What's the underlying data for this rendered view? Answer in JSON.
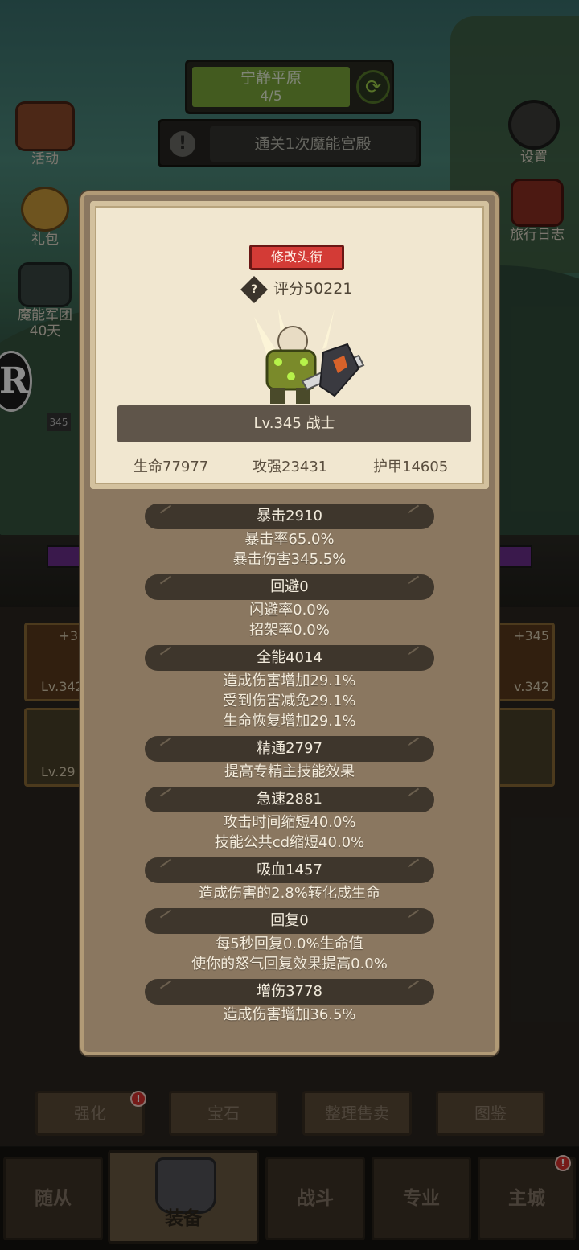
{
  "stage": {
    "name": "宁静平原",
    "progress": "4/5"
  },
  "quest": {
    "text": "通关1次魔能宫殿"
  },
  "left_menu": [
    {
      "label": "活动"
    },
    {
      "label": "礼包"
    },
    {
      "label": "魔能军团",
      "sub": "40天"
    }
  ],
  "right_menu": [
    {
      "label": "设置"
    },
    {
      "label": "旅行日志"
    }
  ],
  "background_slots": {
    "level_tag": "345",
    "left_top": {
      "bonus": "+3",
      "level": "Lv.342"
    },
    "left_bottom": {
      "level": "Lv.29"
    },
    "right_top": {
      "bonus": "+345",
      "level": "v.342"
    }
  },
  "panel": {
    "title_button": "修改头衔",
    "score": "评分50221",
    "level_class": "Lv.345 战士",
    "core_stats": {
      "hp": "生命77977",
      "attack": "攻强23431",
      "armor": "护甲14605"
    },
    "sections": [
      {
        "header": "暴击2910",
        "lines": [
          "暴击率65.0%",
          "暴击伤害345.5%"
        ]
      },
      {
        "header": "回避0",
        "lines": [
          "闪避率0.0%",
          "招架率0.0%"
        ]
      },
      {
        "header": "全能4014",
        "lines": [
          "造成伤害增加29.1%",
          "受到伤害减免29.1%",
          "生命恢复增加29.1%"
        ]
      },
      {
        "header": "精通2797",
        "lines": [
          "提高专精主技能效果"
        ]
      },
      {
        "header": "急速2881",
        "lines": [
          "攻击时间缩短40.0%",
          "技能公共cd缩短40.0%"
        ]
      },
      {
        "header": "吸血1457",
        "lines": [
          "造成伤害的2.8%转化成生命"
        ]
      },
      {
        "header": "回复0",
        "lines": [
          "每5秒回复0.0%生命值",
          "使你的怒气回复效果提高0.0%"
        ]
      },
      {
        "header": "增伤3778",
        "lines": [
          "造成伤害增加36.5%"
        ]
      }
    ]
  },
  "function_buttons": [
    {
      "label": "强化",
      "alert": "!"
    },
    {
      "label": "宝石"
    },
    {
      "label": "整理售卖"
    },
    {
      "label": "图鉴"
    }
  ],
  "nav": [
    {
      "label": "随从"
    },
    {
      "label": "装备",
      "active": true
    },
    {
      "label": "战斗"
    },
    {
      "label": "专业"
    },
    {
      "label": "主城",
      "alert": "!"
    }
  ]
}
